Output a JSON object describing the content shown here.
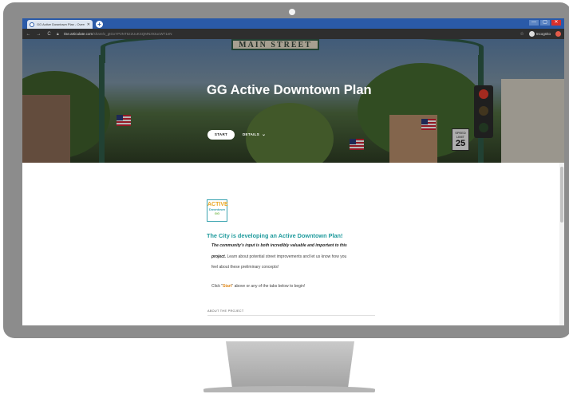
{
  "browser": {
    "tab_title": "GG Active Downtown Plan - Overview",
    "tab_close": "✕",
    "new_tab": "+",
    "url_host": "rise.articulate.com",
    "url_path": "/share/x_gtGxYP2NT6z2UuKSQMNz93ucWT1eN",
    "incognito_label": "Incognito",
    "win_min": "—",
    "win_max": "▢",
    "win_close": "✕"
  },
  "hero": {
    "title": "GG Active Downtown Plan",
    "start_label": "START",
    "details_label": "DETAILS",
    "arch_sign": "MAIN STREET",
    "speed_sign_top": "SPEED LIMIT",
    "speed_sign_value": "25"
  },
  "content": {
    "logo_line1": "ACTIVE",
    "logo_line2": "Downtown",
    "logo_line3": "GG",
    "heading": "The City is developing an Active Downtown Plan!",
    "para1_em": "The community's input is both incredibly valuable and important to this",
    "para2_em": "project.",
    "para2_rest": " Learn about potential street improvements and let us know how you",
    "para3": "feel about these preliminary concepts!",
    "para4_before": "Click \"",
    "para4_start": "Start",
    "para4_after": "\" above or any of the tabs below to begin!",
    "about_label": "ABOUT THE PROJECT"
  }
}
